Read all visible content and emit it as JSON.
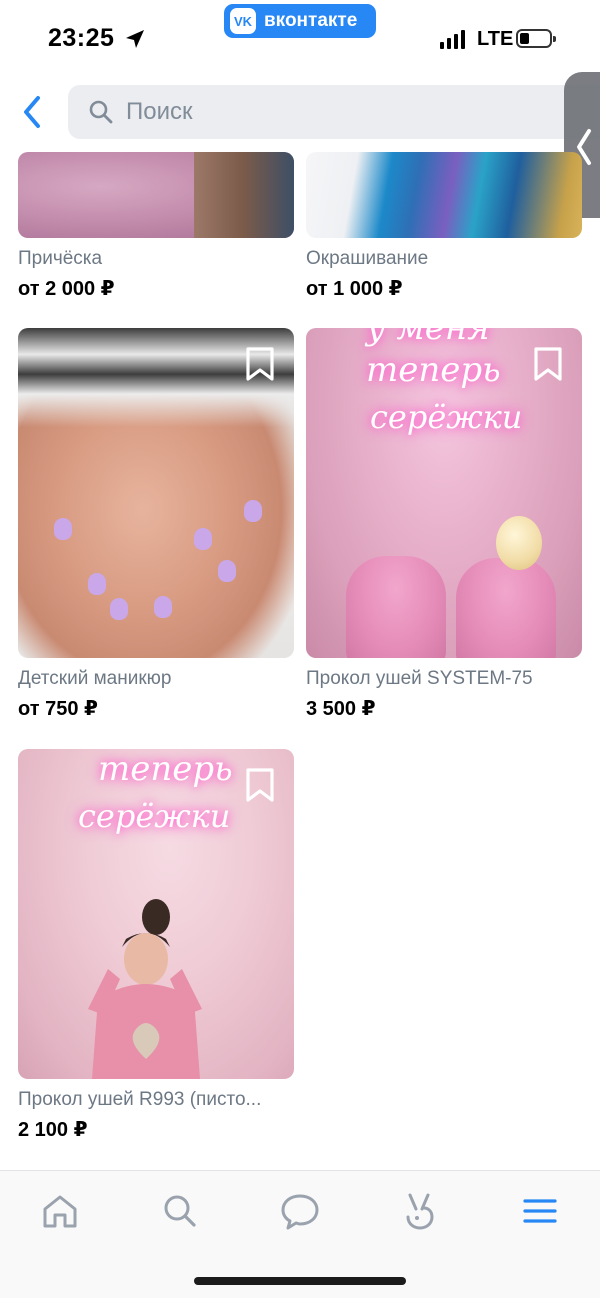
{
  "status_bar": {
    "time": "23:25",
    "carrier_badge": "вконтакте",
    "network": "LTE"
  },
  "search": {
    "placeholder": "Поиск"
  },
  "products": [
    {
      "title": "Причёска",
      "price": "от 2 000 ₽"
    },
    {
      "title": "Окрашивание",
      "price": "от 1 000 ₽"
    },
    {
      "title": "Детский маникюр",
      "price": "от 750 ₽"
    },
    {
      "title": "Прокол ушей SYSTEM-75",
      "price": "3 500 ₽",
      "neon_line1": "у меня",
      "neon_line2": "теперь",
      "neon_line3": "серёжки"
    },
    {
      "title": "Прокол ушей R993 (писто...",
      "price": "2 100 ₽",
      "neon_line1": "теперь",
      "neon_line2": "серёжки"
    }
  ],
  "tabs": [
    "home-icon",
    "search-icon",
    "messages-icon",
    "clips-icon",
    "menu-icon"
  ],
  "colors": {
    "accent": "#2787f5",
    "title_gray": "#6d7885",
    "search_bg": "#ebedf0"
  }
}
